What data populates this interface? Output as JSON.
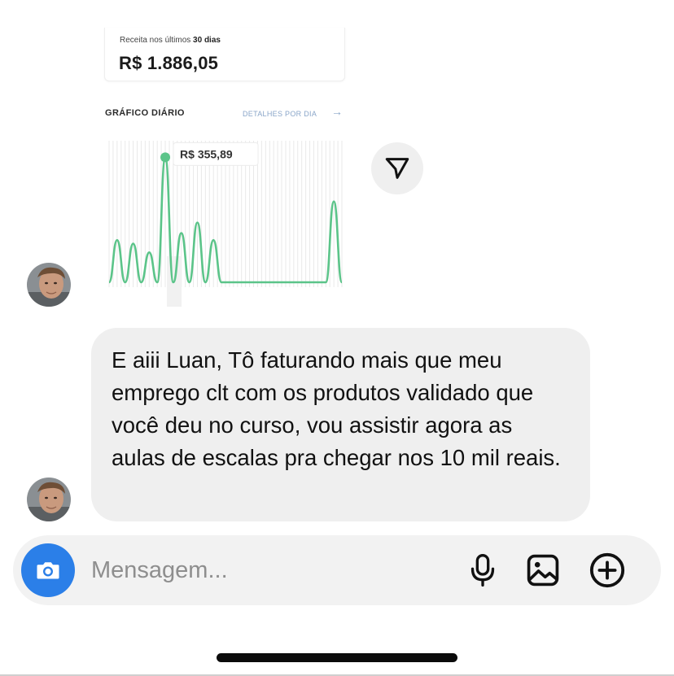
{
  "screenshot_card": {
    "revenue_label": "Receita nos últimos",
    "revenue_period": "30 dias",
    "revenue_value": "R$ 1.886,05",
    "chart_title": "GRÁFICO DIÁRIO",
    "details_link": "DETALHES POR DIA",
    "details_arrow": "→"
  },
  "chart_data": {
    "type": "line",
    "x": [
      1,
      2,
      3,
      4,
      5,
      6,
      7,
      8,
      9,
      10,
      11,
      12,
      13,
      14,
      15,
      16,
      17,
      18,
      19,
      20,
      21,
      22,
      23,
      24,
      25,
      26,
      27,
      28,
      29,
      30
    ],
    "series": [
      {
        "values": [
          0,
          120,
          0,
          110,
          0,
          85,
          0,
          355.89,
          0,
          140,
          0,
          170,
          0,
          120,
          0,
          0,
          0,
          0,
          0,
          0,
          0,
          0,
          0,
          0,
          0,
          0,
          0,
          0,
          230,
          0
        ],
        "color": "#5bc489"
      }
    ],
    "tooltip_value": "R$ 355,89",
    "tooltip_index": 7,
    "ylim": [
      0,
      380
    ],
    "grid": "vertical"
  },
  "send_button": {
    "icon": "paper-plane-icon"
  },
  "message": {
    "text": "E aiii Luan, Tô faturando mais que meu emprego clt com os produtos validado que você deu no curso, vou assistir agora as aulas de escalas pra chegar nos 10 mil reais."
  },
  "composer": {
    "placeholder": "Mensagem...",
    "camera_icon": "camera-icon",
    "mic_icon": "microphone-icon",
    "gallery_icon": "image-icon",
    "add_icon": "plus-circle-icon",
    "accent": "#2b7fe8"
  }
}
